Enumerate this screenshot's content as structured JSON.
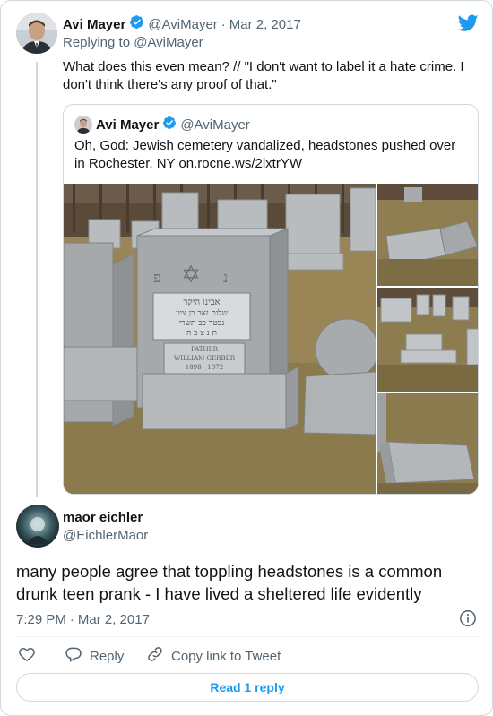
{
  "parent_tweet": {
    "display_name": "Avi Mayer",
    "handle": "@AviMayer",
    "separator": "·",
    "date": "Mar 2, 2017",
    "replying_to": "Replying to @AviMayer",
    "text": "What does this even mean? // \"I don't want to label it a hate crime. I don't think there's any proof of that.\""
  },
  "quoted_tweet": {
    "display_name": "Avi Mayer",
    "handle": "@AviMayer",
    "text": "Oh, God: Jewish cemetery vandalized, headstones pushed over in Rochester, NY on.rocne.ws/2lxtrYW",
    "headstone_inscription": {
      "hebrew_line1": "אבינו היקר",
      "hebrew_line2": "שלום זאב בן ציון",
      "hebrew_line3": "נפטר כב תשרי",
      "hebrew_line4": "ת נ צ ב ה",
      "english_line1": "FATHER",
      "english_line2": "WILLIAM GERBER",
      "english_line3": "1898 - 1972",
      "letter_left": "פ",
      "letter_right": "נ"
    }
  },
  "reply": {
    "display_name": "maor eichler",
    "handle": "@EichlerMaor",
    "text": "many people agree that toppling headstones is a common drunk teen prank - I have lived a sheltered life evidently",
    "time": "7:29 PM",
    "separator": "·",
    "date": "Mar 2, 2017"
  },
  "actions": {
    "reply_label": "Reply",
    "copy_label": "Copy link to Tweet",
    "read_replies_label": "Read 1 reply"
  },
  "icons": {
    "brand": "twitter-bird-icon",
    "verified": "verified-badge-icon",
    "info": "info-icon",
    "like": "heart-icon",
    "reply": "reply-bubble-icon",
    "link": "link-icon"
  },
  "colors": {
    "accent": "#1d9bf0",
    "text": "#0f1419",
    "muted": "#536471",
    "border": "#cfd9de"
  }
}
